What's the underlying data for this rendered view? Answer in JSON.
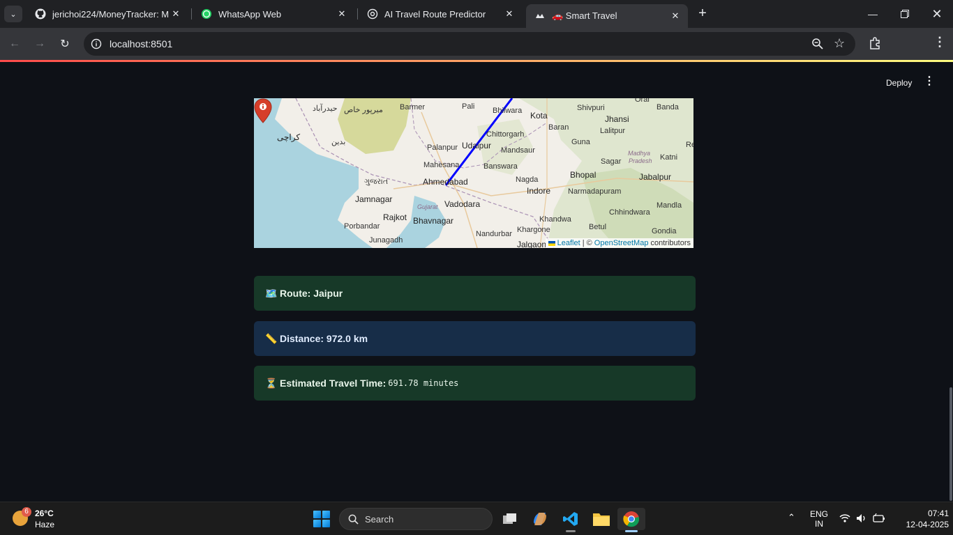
{
  "browser": {
    "tabs": [
      {
        "title": "jerichoi224/MoneyTracker: Mon",
        "icon": "github-icon",
        "active": false
      },
      {
        "title": "WhatsApp Web",
        "icon": "whatsapp-icon",
        "active": false
      },
      {
        "title": "AI Travel Route Predictor",
        "icon": "openai-icon",
        "active": false
      },
      {
        "title": "🚗 Smart Travel",
        "icon": "streamlit-icon",
        "active": true
      }
    ],
    "url": "localhost:8501"
  },
  "app": {
    "deploy_label": "Deploy",
    "map": {
      "labels": [
        {
          "text": "Barmer",
          "cls": "city"
        },
        {
          "text": "Pali",
          "cls": "city"
        },
        {
          "text": "Bhilwara",
          "cls": "city"
        },
        {
          "text": "Kota",
          "cls": "big"
        },
        {
          "text": "Shivpuri",
          "cls": "city"
        },
        {
          "text": "Orai",
          "cls": "city"
        },
        {
          "text": "Banda",
          "cls": "city"
        },
        {
          "text": "Jhansi",
          "cls": "big"
        },
        {
          "text": "Baran",
          "cls": "city"
        },
        {
          "text": "Lalitpur",
          "cls": "city"
        },
        {
          "text": "Udaipur",
          "cls": "big"
        },
        {
          "text": "Chittorgarh",
          "cls": "city"
        },
        {
          "text": "Guna",
          "cls": "city"
        },
        {
          "text": "Palanpur",
          "cls": "city"
        },
        {
          "text": "Mandsaur",
          "cls": "city"
        },
        {
          "text": "Madhya",
          "cls": "region"
        },
        {
          "text": "Pradesh",
          "cls": "region"
        },
        {
          "text": "Katni",
          "cls": "city"
        },
        {
          "text": "Sagar",
          "cls": "city"
        },
        {
          "text": "Mahesana",
          "cls": "city"
        },
        {
          "text": "Banswara",
          "cls": "city"
        },
        {
          "text": "Bhopal",
          "cls": "big"
        },
        {
          "text": "Jabalpur",
          "cls": "big"
        },
        {
          "text": "Ahmedabad",
          "cls": "big"
        },
        {
          "text": "Nagda",
          "cls": "city"
        },
        {
          "text": "Indore",
          "cls": "big"
        },
        {
          "text": "Narmadapuram",
          "cls": "city"
        },
        {
          "text": "Jamnagar",
          "cls": "big"
        },
        {
          "text": "Gujarat",
          "cls": "region"
        },
        {
          "text": "Vadodara",
          "cls": "big"
        },
        {
          "text": "Chhindwara",
          "cls": "city"
        },
        {
          "text": "Mandla",
          "cls": "city"
        },
        {
          "text": "Rajkot",
          "cls": "big"
        },
        {
          "text": "Porbandar",
          "cls": "city"
        },
        {
          "text": "Bhavnagar",
          "cls": "big"
        },
        {
          "text": "Khandwa",
          "cls": "city"
        },
        {
          "text": "Khargone",
          "cls": "city"
        },
        {
          "text": "Betul",
          "cls": "city"
        },
        {
          "text": "Gondia",
          "cls": "city"
        },
        {
          "text": "Junagadh",
          "cls": "city"
        },
        {
          "text": "Nandurbar",
          "cls": "city"
        },
        {
          "text": "Jalgaon",
          "cls": "big"
        },
        {
          "text": "کراچی",
          "cls": "big"
        },
        {
          "text": "حیدرآباد",
          "cls": "city"
        },
        {
          "text": "میرپور خاص",
          "cls": "city"
        },
        {
          "text": "بدین",
          "cls": "city"
        },
        {
          "text": "ગુજરાત",
          "cls": "city"
        },
        {
          "text": "Re",
          "cls": "city"
        }
      ],
      "attribution": {
        "leaflet": "Leaflet",
        "sep": "| ©",
        "osm": "OpenStreetMap",
        "suffix": "contributors"
      }
    },
    "route": {
      "emoji": "🗺️",
      "text": "Route: Jaipur"
    },
    "distance": {
      "emoji": "📏",
      "text": "Distance: 972.0 km"
    },
    "travel_time": {
      "emoji": "⏳",
      "label": "Estimated Travel Time:",
      "value": "691.78 minutes"
    }
  },
  "taskbar": {
    "weather": {
      "temp": "26°C",
      "condition": "Haze",
      "badge": "6"
    },
    "search_placeholder": "Search",
    "language": {
      "line1": "ENG",
      "line2": "IN"
    },
    "clock": {
      "time": "07:41",
      "date": "12-04-2025"
    }
  }
}
